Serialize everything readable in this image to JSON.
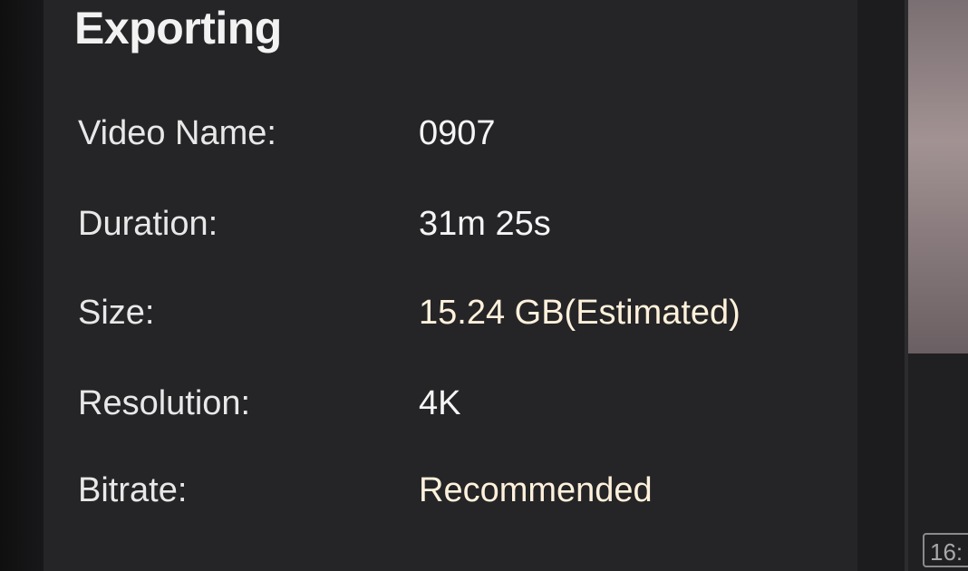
{
  "dialog": {
    "title": "Exporting",
    "rows": [
      {
        "label": "Video Name:",
        "value": "0907"
      },
      {
        "label": "Duration:",
        "value": "31m 25s"
      },
      {
        "label": "Size:",
        "value": "15.24 GB(Estimated)"
      },
      {
        "label": "Resolution:",
        "value": "4K"
      },
      {
        "label": "Bitrate:",
        "value": "Recommended"
      }
    ]
  },
  "preview": {
    "aspect_ratio_badge": "16:"
  }
}
